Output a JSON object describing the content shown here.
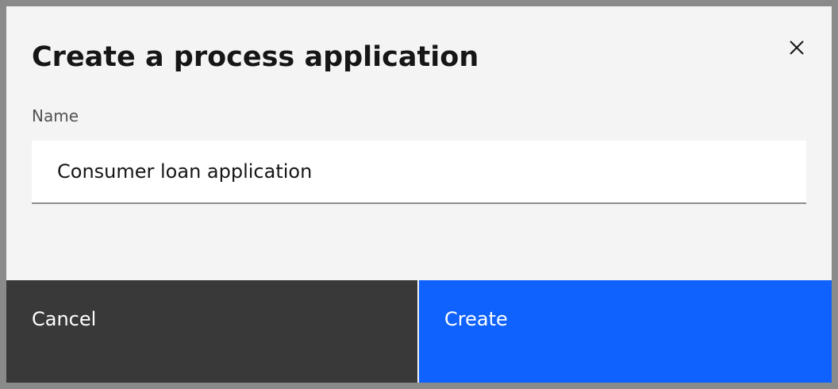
{
  "dialog": {
    "title": "Create a process application",
    "close_icon": "close-icon"
  },
  "form": {
    "name_label": "Name",
    "name_value": "Consumer loan application"
  },
  "footer": {
    "cancel_label": "Cancel",
    "create_label": "Create"
  },
  "colors": {
    "primary": "#0f62fe",
    "secondary": "#393939",
    "background": "#f4f4f4"
  }
}
